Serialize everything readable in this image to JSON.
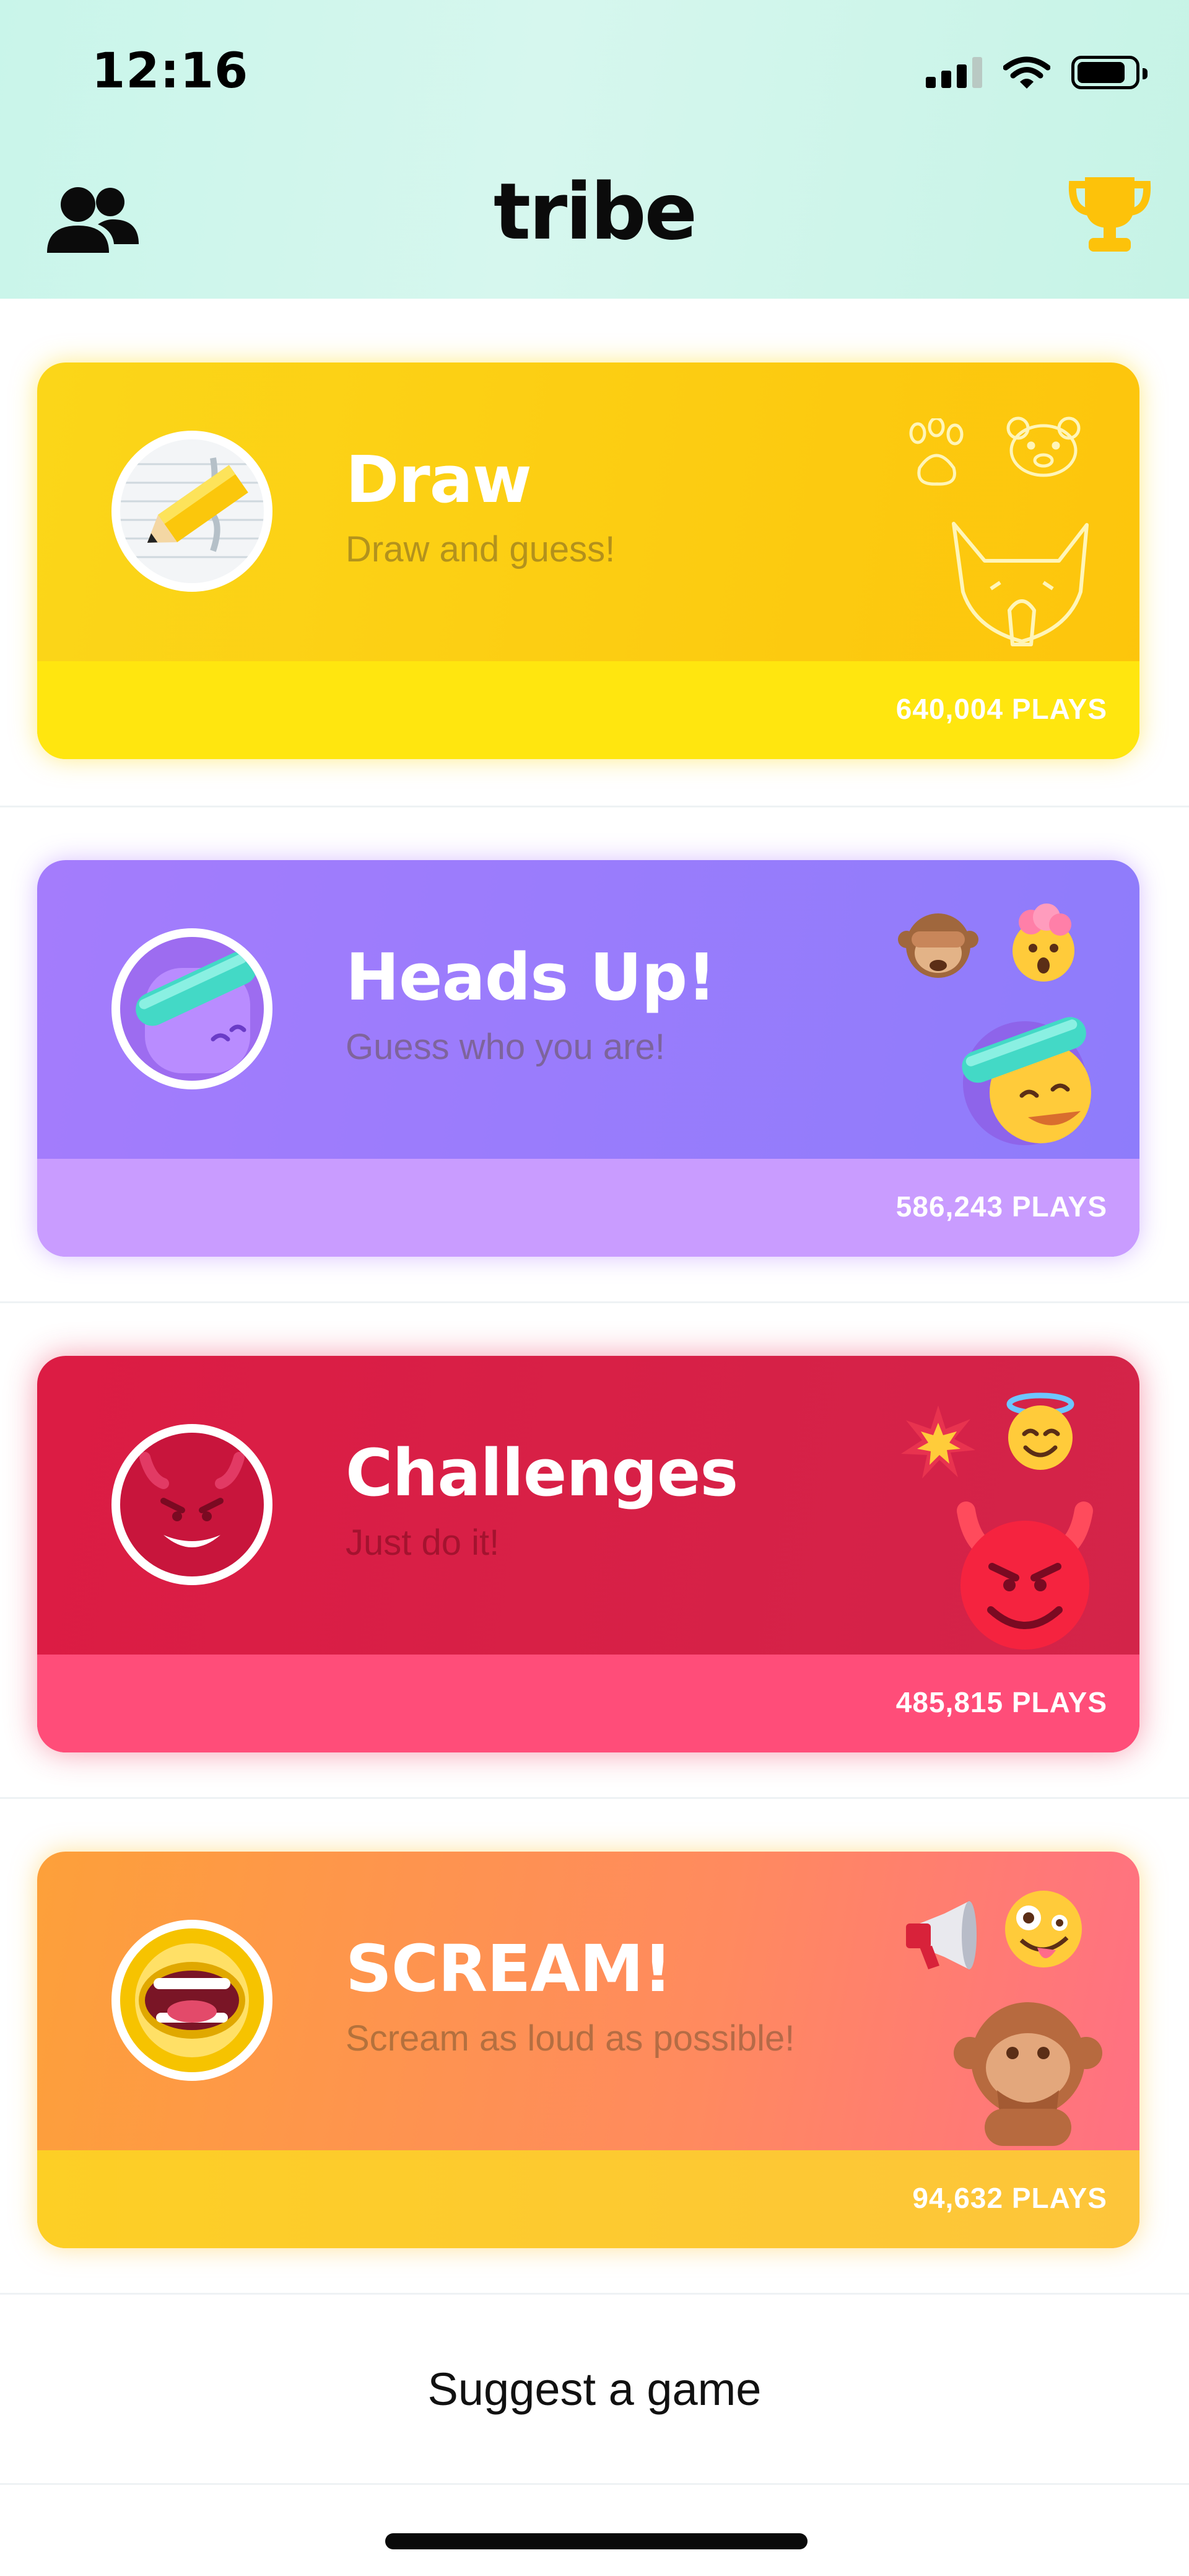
{
  "status_bar": {
    "time": "12:16",
    "icons": [
      "signal-icon",
      "wifi-icon",
      "battery-icon"
    ]
  },
  "header": {
    "title": "tribe",
    "left_icon": "friends-icon",
    "right_icon": "trophy-icon",
    "trophy_color": "#fdc20a"
  },
  "games": [
    {
      "title": "Draw",
      "subtitle": "Draw and guess!",
      "plays": "640,004 PLAYS",
      "icon": "pencil-icon",
      "accent": "#fbd619",
      "decorations": [
        "paw-doodle",
        "bear-doodle",
        "wolf-doodle"
      ]
    },
    {
      "title": "Heads Up!",
      "subtitle": "Guess who you are!",
      "plays": "586,243 PLAYS",
      "icon": "headband-face-icon",
      "accent": "#a47cfc",
      "decorations": [
        "see-no-evil-monkey",
        "exploding-head",
        "headband-face"
      ]
    },
    {
      "title": "Challenges",
      "subtitle": "Just do it!",
      "plays": "485,815 PLAYS",
      "icon": "devil-icon",
      "accent": "#dc1c44",
      "decorations": [
        "collision",
        "halo-face",
        "smiling-devil"
      ]
    },
    {
      "title": "SCREAM!",
      "subtitle": "Scream as loud as possible!",
      "plays": "94,632 PLAYS",
      "icon": "mouth-icon",
      "accent": "#ff8a5f",
      "decorations": [
        "megaphone",
        "zany-face",
        "speak-no-evil-monkey"
      ]
    }
  ],
  "suggest": {
    "label": "Suggest a game"
  }
}
